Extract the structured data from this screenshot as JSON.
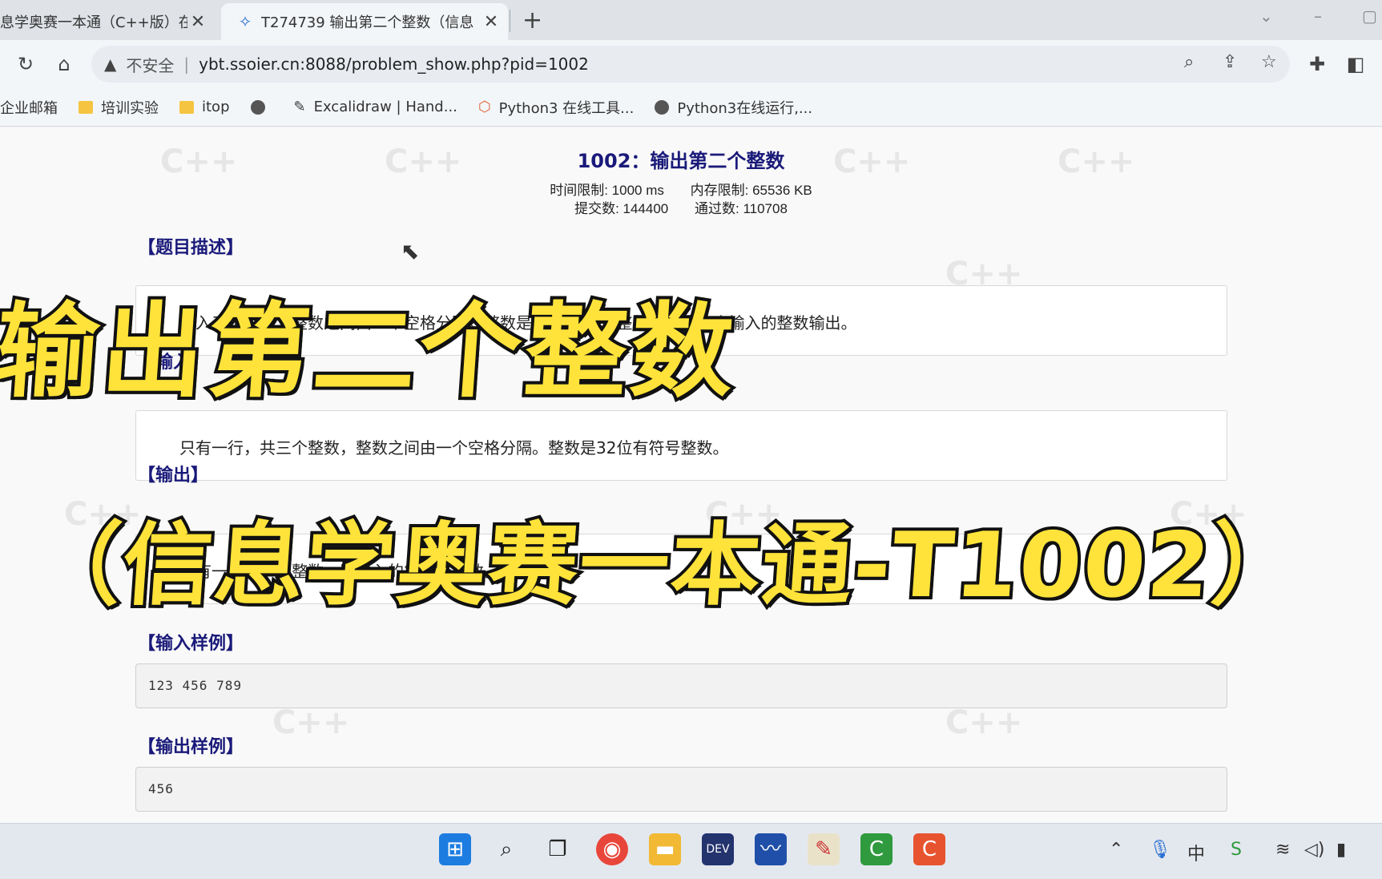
{
  "tabs": [
    {
      "title": "息学奥赛一本通（C++版）在线",
      "active": false
    },
    {
      "title": "T274739 输出第二个整数（信息",
      "active": true
    }
  ],
  "toolbar": {
    "security_warning": "不安全",
    "url": "ybt.ssoier.cn:8088/problem_show.php?pid=1002"
  },
  "bookmarks": [
    {
      "label": "企业邮箱",
      "icon": "none"
    },
    {
      "label": "培训实验",
      "icon": "folder-icon"
    },
    {
      "label": "itop",
      "icon": "folder-icon"
    },
    {
      "label": "",
      "icon": "globe-icon"
    },
    {
      "label": "Excalidraw | Hand...",
      "icon": "excalidraw-icon"
    },
    {
      "label": "Python3 在线工具...",
      "icon": "python-tool-icon"
    },
    {
      "label": "Python3在线运行,...",
      "icon": "globe-icon"
    }
  ],
  "problem": {
    "title": "1002：输出第二个整数",
    "time_limit": "时间限制: 1000 ms",
    "memory_limit": "内存限制: 65536 KB",
    "submissions": "提交数: 144400",
    "accepted": "通过数: 110708",
    "sections": {
      "description_head": "【题目描述】",
      "description_text": "输入三个整数，整数之间由一个空格分隔。整数是32位有符号整数。把第二个输入的整数输出。",
      "input_head": "【输入】",
      "input_text": "只有一行，共三个整数，整数之间由一个空格分隔。整数是32位有符号整数。",
      "output_head": "【输出】",
      "output_text": "只有一行，一个整数，即输入的第二个整数。",
      "sample_input_head": "【输入样例】",
      "sample_input": "123 456 789",
      "sample_output_head": "【输出样例】",
      "sample_output": "456"
    }
  },
  "overlay": {
    "line1": "输出第二个整数",
    "line2": "（信息学奥赛一本通-T1002）"
  },
  "watermark_text": "C++",
  "taskbar_apps": [
    "start-icon",
    "search-icon",
    "taskview-icon",
    "chrome-icon",
    "file-explorer-icon",
    "devcpp-icon",
    "whiteboard-icon",
    "paint-icon",
    "camtasia-green-icon",
    "camtasia-icon"
  ],
  "colors": {
    "title": "#1a1a7a",
    "overlay_fill": "#ffe33a",
    "overlay_stroke": "#111111"
  }
}
